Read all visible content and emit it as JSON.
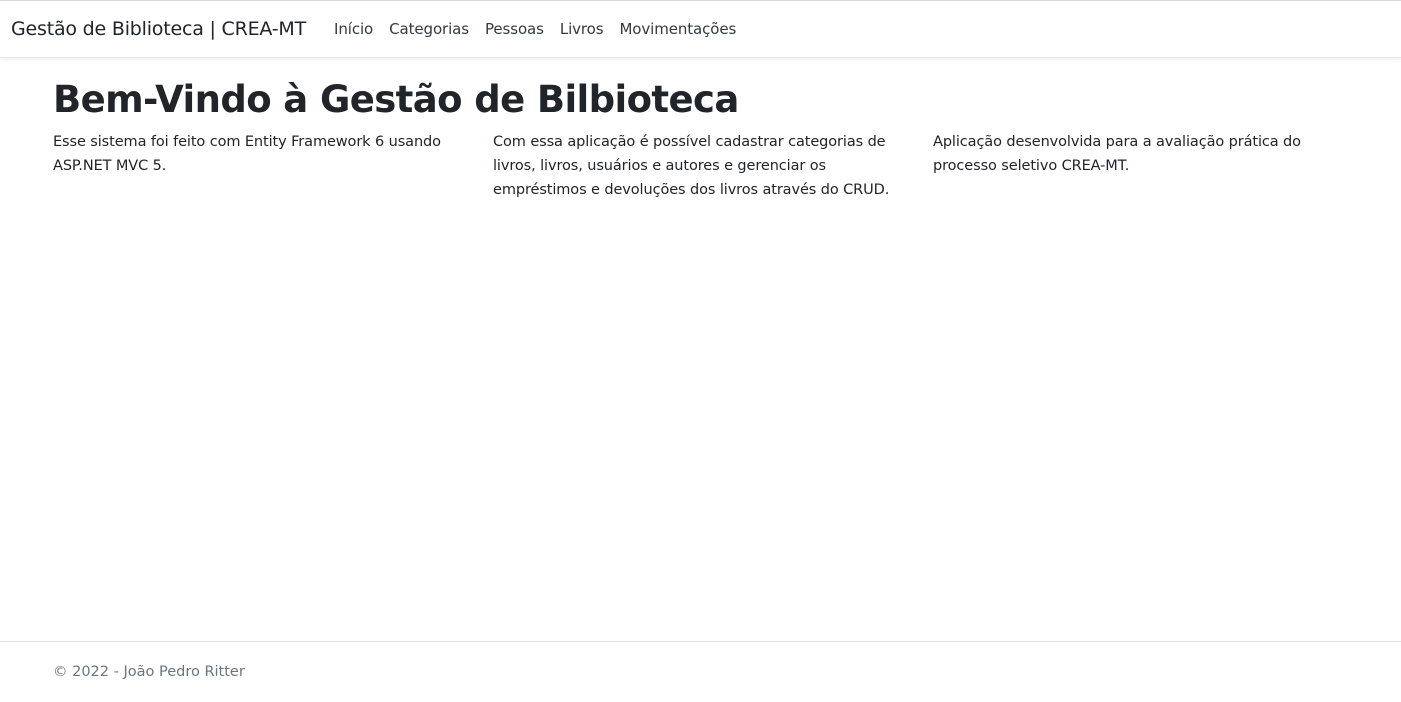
{
  "navbar": {
    "brand": "Gestão de Biblioteca | CREA-MT",
    "links": [
      {
        "label": "Início"
      },
      {
        "label": "Categorias"
      },
      {
        "label": "Pessoas"
      },
      {
        "label": "Livros"
      },
      {
        "label": "Movimentações"
      }
    ]
  },
  "main": {
    "title": "Bem-Vindo à Gestão de Bilbioteca",
    "columns": [
      {
        "text": "Esse sistema foi feito com Entity Framework 6 usando ASP.NET MVC 5."
      },
      {
        "text": "Com essa aplicação é possível cadastrar categorias de livros, livros, usuários e autores e gerenciar os empréstimos e devoluções dos livros através do CRUD."
      },
      {
        "text": "Aplicação desenvolvida para a avaliação prática do processo seletivo CREA-MT."
      }
    ]
  },
  "footer": {
    "text": "© 2022 - João Pedro Ritter"
  }
}
